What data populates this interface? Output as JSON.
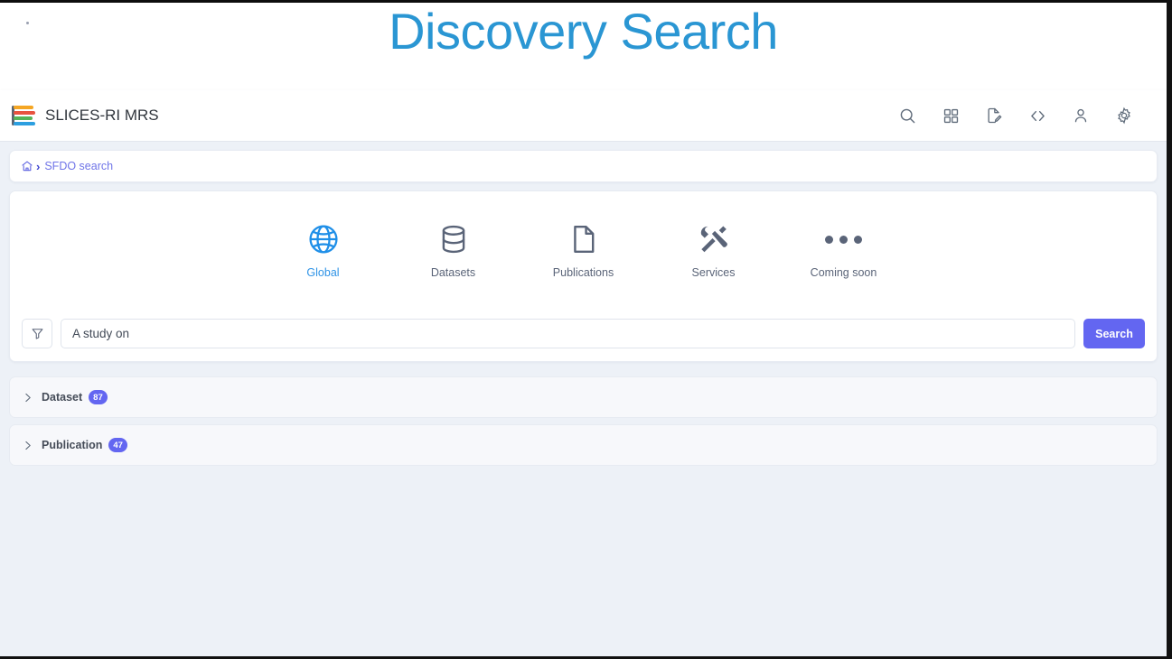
{
  "page": {
    "title": "Discovery Search",
    "title_color": "#2a96d3",
    "background_color": "#edf1f7"
  },
  "appbar": {
    "brand_name": "SLICES-RI MRS",
    "logo_bar_colors": [
      "#f5a623",
      "#e8533f",
      "#56b356",
      "#2c9fe0"
    ],
    "icons": [
      {
        "name": "search-icon",
        "label": "Search"
      },
      {
        "name": "grid-icon",
        "label": "Apps"
      },
      {
        "name": "file-edit-icon",
        "label": "Edit document"
      },
      {
        "name": "code-icon",
        "label": "Code"
      },
      {
        "name": "person-icon",
        "label": "Account"
      },
      {
        "name": "gear-icon",
        "label": "Settings"
      }
    ]
  },
  "breadcrumb": {
    "home_icon": "home-icon",
    "separator": "›",
    "current": "SFDO search"
  },
  "search_panel": {
    "tabs": [
      {
        "label": "Global",
        "icon": "globe-icon",
        "active": true
      },
      {
        "label": "Datasets",
        "icon": "database-icon",
        "active": false
      },
      {
        "label": "Publications",
        "icon": "document-icon",
        "active": false
      },
      {
        "label": "Services",
        "icon": "tools-icon",
        "active": false
      },
      {
        "label": "Coming soon",
        "icon": "ellipsis-icon",
        "active": false
      }
    ],
    "filter_icon": "filter-icon",
    "input_value": "A study on",
    "input_placeholder": "A study on",
    "search_button_label": "Search",
    "accent_color": "#6366f1"
  },
  "results": {
    "sections": [
      {
        "title": "Dataset",
        "count": "87",
        "expanded": false
      },
      {
        "title": "Publication",
        "count": "47",
        "expanded": false
      }
    ]
  }
}
